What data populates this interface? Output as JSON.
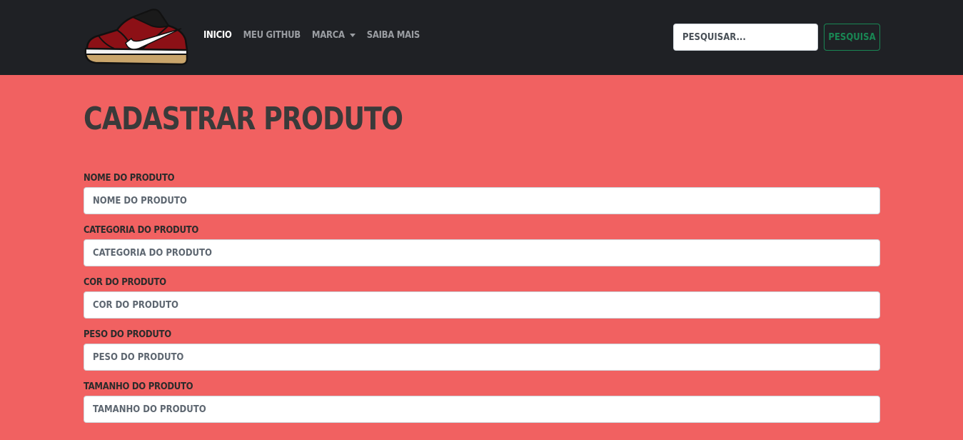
{
  "nav": {
    "links": [
      {
        "label": "Inicio",
        "active": true
      },
      {
        "label": "Meu Github",
        "active": false
      },
      {
        "label": "Marca",
        "active": false,
        "dropdown": true
      },
      {
        "label": "Saiba Mais",
        "active": false
      }
    ],
    "search_placeholder": "Pesquisar...",
    "search_button": "Pesquisa"
  },
  "page": {
    "title": "Cadastrar Produto"
  },
  "form": {
    "fields": [
      {
        "label": "Nome do produto",
        "placeholder": "Nome do produto"
      },
      {
        "label": "Categoria do produto",
        "placeholder": "Categoria do produto"
      },
      {
        "label": "Cor do produto",
        "placeholder": "Cor do produto"
      },
      {
        "label": "Peso do produto",
        "placeholder": "Peso do produto"
      },
      {
        "label": "Tamanho do produto",
        "placeholder": "Tamanho do produto"
      }
    ]
  },
  "colors": {
    "background": "#f16161",
    "navbar": "#1f2125",
    "accent_green": "#198754"
  },
  "icons": {
    "logo": "sneaker-logo"
  }
}
